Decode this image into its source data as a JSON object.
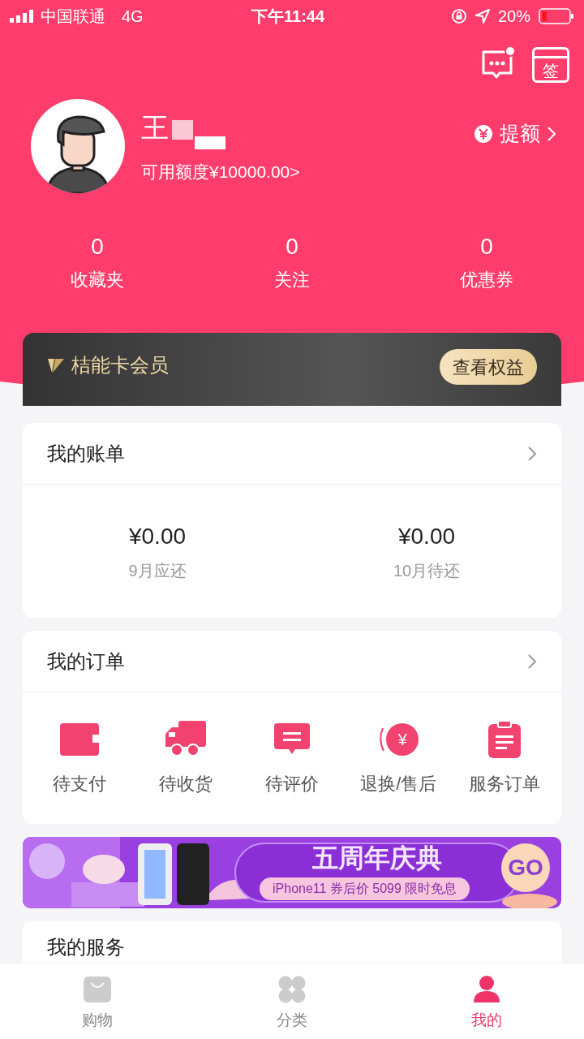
{
  "status_bar": {
    "carrier": "中国联通",
    "network": "4G",
    "time": "下午11:44",
    "battery": "20%"
  },
  "header": {
    "message_unread": true,
    "checkin_label": "签",
    "user_name": "王",
    "credit": "可用额度¥10000.00>",
    "raise_limit": "提额"
  },
  "stats": [
    {
      "value": "0",
      "label": "收藏夹"
    },
    {
      "value": "0",
      "label": "关注"
    },
    {
      "value": "0",
      "label": "优惠券"
    }
  ],
  "membership": {
    "title": "桔能卡会员",
    "button": "查看权益"
  },
  "bill": {
    "title": "我的账单",
    "items": [
      {
        "amount": "¥0.00",
        "label": "9月应还"
      },
      {
        "amount": "¥0.00",
        "label": "10月待还"
      }
    ]
  },
  "orders": {
    "title": "我的订单",
    "items": [
      {
        "kind": "wallet",
        "label": "待支付"
      },
      {
        "kind": "truck",
        "label": "待收货"
      },
      {
        "kind": "comment",
        "label": "待评价"
      },
      {
        "kind": "refund",
        "label": "退换/售后",
        "symbol": "¥"
      },
      {
        "kind": "clipboard",
        "label": "服务订单"
      }
    ]
  },
  "banner": {
    "title": "五周年庆典",
    "subtitle": "iPhone11 券后价 5099 限时免息",
    "go": "GO"
  },
  "services": {
    "title": "我的服务"
  },
  "tab_bar": [
    {
      "kind": "bag",
      "label": "购物",
      "selected": false
    },
    {
      "kind": "clover",
      "label": "分类",
      "selected": false
    },
    {
      "kind": "person",
      "label": "我的",
      "selected": true
    }
  ]
}
